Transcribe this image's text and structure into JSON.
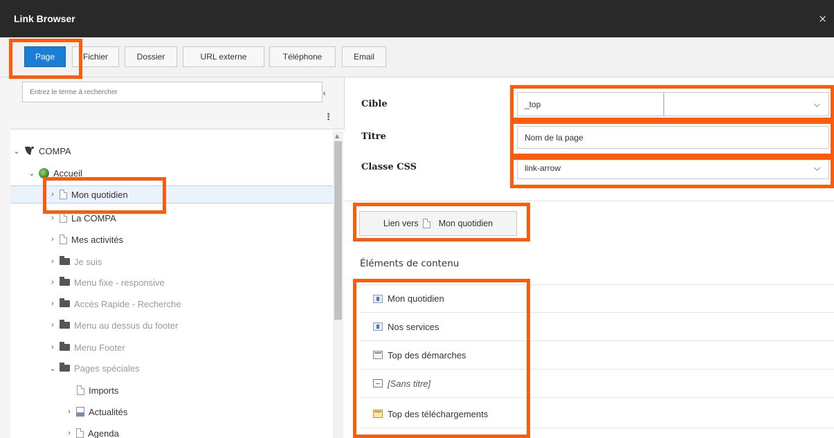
{
  "window": {
    "title": "Link Browser",
    "close_glyph": "×"
  },
  "tabs": [
    {
      "label": "Page",
      "active": true
    },
    {
      "label": "Fichier",
      "active": false
    },
    {
      "label": "Dossier",
      "active": false
    },
    {
      "label": "URL externe",
      "active": false
    },
    {
      "label": "Téléphone",
      "active": false
    },
    {
      "label": "Email",
      "active": false
    }
  ],
  "tree": {
    "search_placeholder": "Entrez le terme à rechercher",
    "items": [
      {
        "label": "COMPA",
        "icon": "typo3-logo-icon",
        "level": 0,
        "expanded": true,
        "muted": false
      },
      {
        "label": "Accueil",
        "icon": "globe-icon",
        "level": 1,
        "expanded": true,
        "muted": false
      },
      {
        "label": "Mon quotidien",
        "icon": "page-icon",
        "level": 2,
        "expanded": false,
        "muted": false,
        "selected": true
      },
      {
        "label": "La COMPA",
        "icon": "page-icon",
        "level": 2,
        "expanded": false,
        "muted": false
      },
      {
        "label": "Mes activités",
        "icon": "page-icon",
        "level": 2,
        "expanded": false,
        "muted": false
      },
      {
        "label": "Je suis",
        "icon": "folder-icon",
        "level": 2,
        "expanded": false,
        "muted": true
      },
      {
        "label": "Menu fixe - responsive",
        "icon": "folder-icon",
        "level": 2,
        "expanded": false,
        "muted": true
      },
      {
        "label": "Accès Rapide - Recherche",
        "icon": "folder-icon",
        "level": 2,
        "expanded": false,
        "muted": true
      },
      {
        "label": "Menu au dessus du footer",
        "icon": "folder-icon",
        "level": 2,
        "expanded": false,
        "muted": true
      },
      {
        "label": "Menu Footer",
        "icon": "folder-icon",
        "level": 2,
        "expanded": false,
        "muted": true
      },
      {
        "label": "Pages spéciales",
        "icon": "folder-icon",
        "level": 2,
        "expanded": true,
        "muted": true
      },
      {
        "label": "Imports",
        "icon": "page-icon",
        "level": 3,
        "expanded": false,
        "muted": false
      },
      {
        "label": "Actualités",
        "icon": "news-icon",
        "level": 3,
        "expanded": false,
        "muted": false
      },
      {
        "label": "Agenda",
        "icon": "page-icon",
        "level": 3,
        "expanded": false,
        "muted": false
      }
    ]
  },
  "form": {
    "target_label": "Cible",
    "target_value": "_top",
    "title_label": "Titre",
    "title_value": "Nom de la page",
    "css_label": "Classe CSS",
    "css_value": "link-arrow"
  },
  "link_button": {
    "prefix": "Lien vers",
    "page": "Mon quotidien"
  },
  "content": {
    "title": "Éléments de contenu",
    "items": [
      {
        "label": "Mon quotidien",
        "icon": "content-text-icon",
        "italic": false
      },
      {
        "label": "Nos services",
        "icon": "content-text-icon",
        "italic": false
      },
      {
        "label": "Top des démarches",
        "icon": "content-list-icon",
        "italic": false
      },
      {
        "label": "[Sans titre]",
        "icon": "content-empty-icon",
        "italic": true
      },
      {
        "label": "Top des téléchargements",
        "icon": "content-download-icon",
        "italic": false
      }
    ]
  },
  "colors": {
    "highlight": "#fe5b0d",
    "active_tab": "#1b7ed6",
    "titlebar": "#292929"
  }
}
